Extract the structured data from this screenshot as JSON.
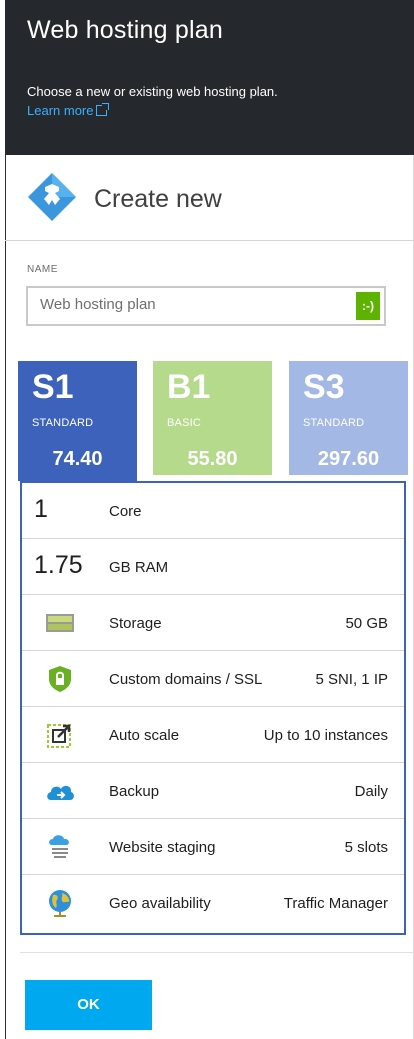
{
  "header": {
    "title": "Web hosting plan",
    "description": "Choose a new or existing web hosting plan.",
    "learn_more": "Learn more"
  },
  "create": {
    "label": "Create new"
  },
  "name_field": {
    "label": "NAME",
    "value": "Web hosting plan",
    "status": ":-)"
  },
  "tiers": [
    {
      "code": "S1",
      "name": "STANDARD",
      "price": "74.40",
      "color": "#3c62bc"
    },
    {
      "code": "B1",
      "name": "BASIC",
      "price": "55.80",
      "color": "#b5da8c"
    },
    {
      "code": "S3",
      "name": "STANDARD",
      "price": "297.60",
      "color": "#a3b8e4"
    }
  ],
  "features": [
    {
      "big": "1",
      "label": "Core",
      "value": ""
    },
    {
      "big": "1.75",
      "label": "GB RAM",
      "value": ""
    },
    {
      "icon": "storage-icon",
      "label": "Storage",
      "value": "50 GB"
    },
    {
      "icon": "ssl-shield-icon",
      "label": "Custom domains / SSL",
      "value": "5 SNI, 1 IP"
    },
    {
      "icon": "autoscale-icon",
      "label": "Auto scale",
      "value": "Up to 10 instances"
    },
    {
      "icon": "backup-cloud-icon",
      "label": "Backup",
      "value": "Daily"
    },
    {
      "icon": "staging-icon",
      "label": "Website staging",
      "value": "5 slots"
    },
    {
      "icon": "globe-icon",
      "label": "Geo availability",
      "value": "Traffic Manager"
    }
  ],
  "footer": {
    "ok_label": "OK"
  },
  "colors": {
    "header_bg": "#25282d",
    "accent": "#00a8f0",
    "selected_tier": "#3c62bc"
  }
}
